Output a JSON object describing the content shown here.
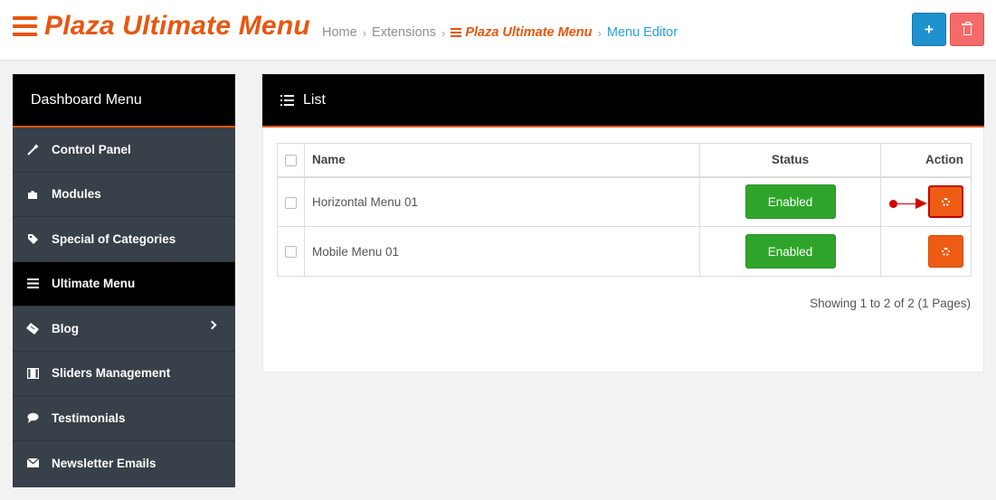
{
  "header": {
    "title": "Plaza Ultimate Menu",
    "breadcrumb": [
      "Home",
      "Extensions",
      "Plaza Ultimate Menu",
      "Menu Editor"
    ],
    "add_button": "+"
  },
  "sidebar": {
    "title": "Dashboard Menu",
    "items": [
      {
        "label": "Control Panel",
        "icon": "magic-wand-icon"
      },
      {
        "label": "Modules",
        "icon": "puzzle-icon"
      },
      {
        "label": "Special of Categories",
        "icon": "tag-icon"
      },
      {
        "label": "Ultimate Menu",
        "icon": "bars-icon",
        "active": true
      },
      {
        "label": "Blog",
        "icon": "ticket-icon",
        "has_submenu": true
      },
      {
        "label": "Sliders Management",
        "icon": "film-icon"
      },
      {
        "label": "Testimonials",
        "icon": "comment-icon"
      },
      {
        "label": "Newsletter Emails",
        "icon": "envelope-icon"
      }
    ]
  },
  "panel": {
    "title": "List",
    "columns": {
      "name": "Name",
      "status": "Status",
      "action": "Action"
    },
    "rows": [
      {
        "name": "Horizontal Menu 01",
        "status": "Enabled"
      },
      {
        "name": "Mobile Menu 01",
        "status": "Enabled"
      }
    ],
    "pagination": "Showing 1 to 2 of 2 (1 Pages)"
  },
  "colors": {
    "accent": "#e8560f",
    "enabled": "#2ea52a",
    "add": "#1e91cf",
    "delete": "#f56b6b",
    "sidebar": "#384049"
  }
}
